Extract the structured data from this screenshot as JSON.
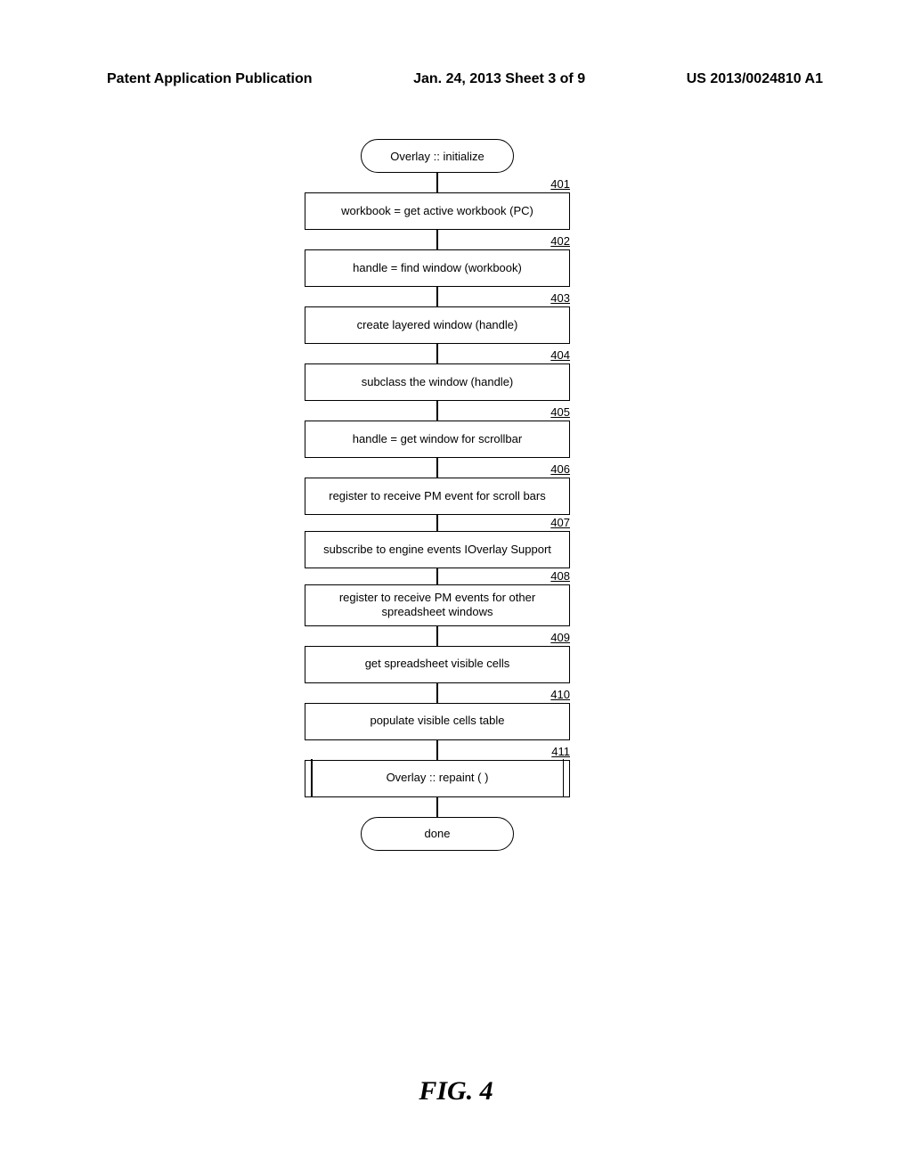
{
  "header": {
    "left": "Patent Application Publication",
    "center": "Jan. 24, 2013  Sheet 3 of 9",
    "right": "US 2013/0024810 A1"
  },
  "flowchart": {
    "start": "Overlay :: initialize",
    "steps": [
      {
        "num": "401",
        "text": "workbook = get active workbook (PC)"
      },
      {
        "num": "402",
        "text": "handle = find window (workbook)"
      },
      {
        "num": "403",
        "text": "create layered window (handle)"
      },
      {
        "num": "404",
        "text": "subclass the window (handle)"
      },
      {
        "num": "405",
        "text": "handle = get window for scrollbar"
      },
      {
        "num": "406",
        "text": "register to receive PM event for scroll bars"
      },
      {
        "num": "407",
        "text": "subscribe to engine events IOverlay Support"
      },
      {
        "num": "408",
        "text": "register to receive PM events for other spreadsheet windows"
      },
      {
        "num": "409",
        "text": "get spreadsheet visible cells"
      },
      {
        "num": "410",
        "text": "populate visible cells table"
      },
      {
        "num": "411",
        "text": "Overlay :: repaint ( )"
      }
    ],
    "end": "done"
  },
  "figure_label": "FIG. 4"
}
